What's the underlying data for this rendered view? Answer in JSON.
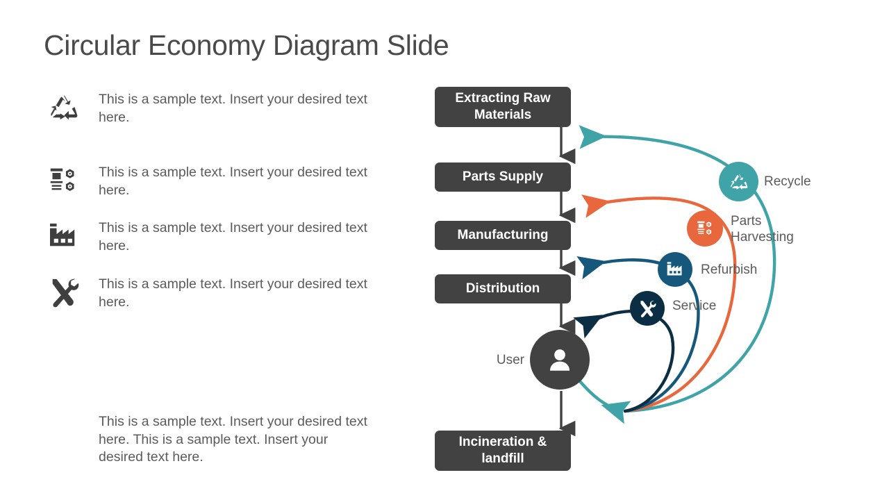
{
  "slide": {
    "title": "Circular Economy Diagram Slide",
    "background_color": "#ffffff"
  },
  "left_panel": {
    "bullets": [
      {
        "icon": "recycle-icon",
        "text": "This is a sample text. Insert your desired text here."
      },
      {
        "icon": "parts-harvesting-icon",
        "text": "This is a sample text. Insert your desired text here."
      },
      {
        "icon": "factory-icon",
        "text": "This is a sample text. Insert your desired text here."
      },
      {
        "icon": "tools-icon",
        "text": "This is a sample text. Insert your desired text here."
      }
    ],
    "paragraph": "This is a sample text. Insert your desired text here. This is a sample text. Insert your desired text here."
  },
  "flow": {
    "box_color": "#424242",
    "steps": [
      {
        "label": "Extracting Raw Materials"
      },
      {
        "label": "Parts Supply"
      },
      {
        "label": "Manufacturing"
      },
      {
        "label": "Distribution"
      },
      {
        "label": "Incineration & landfill"
      }
    ],
    "user": {
      "label": "User",
      "icon": "user-icon",
      "color": "#424242"
    }
  },
  "cycle_nodes": [
    {
      "label": "Recycle",
      "icon": "recycle-icon",
      "color": "#3fa3a8",
      "target": "Extracting Raw Materials"
    },
    {
      "label": "Parts\nHarvesting",
      "icon": "parts-harvesting-icon",
      "color": "#e8673c",
      "target": "Parts Supply"
    },
    {
      "label": "Refurbish",
      "icon": "factory-icon",
      "color": "#15587c",
      "target": "Manufacturing"
    },
    {
      "label": "Service",
      "icon": "tools-icon",
      "color": "#0c2e44",
      "target": "Distribution"
    }
  ],
  "colors": {
    "recycle_teal": "#3fa3a8",
    "parts_orange": "#e8673c",
    "refurbish_blue": "#15587c",
    "service_navy": "#0c2e44",
    "dark_gray": "#424242",
    "text_gray": "#5b5b5b"
  }
}
